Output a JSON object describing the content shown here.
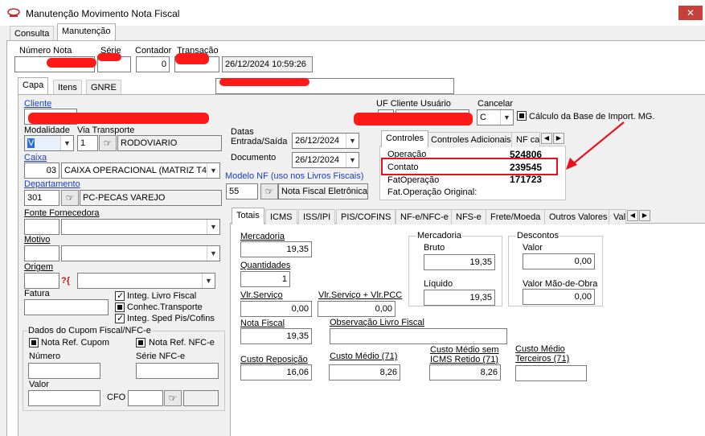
{
  "window": {
    "title": "Manutenção Movimento Nota Fiscal",
    "close_glyph": "✕"
  },
  "top_tabs": [
    "Consulta",
    "Manutenção"
  ],
  "header": {
    "numero_nota_label": "Número Nota",
    "serie_label": "Série",
    "contador_label": "Contador",
    "contador_value": "0",
    "transacao_label": "Transação",
    "datetime": "26/12/2024 10:59:26"
  },
  "sub_tabs": [
    "Capa",
    "Itens",
    "GNRE"
  ],
  "capa": {
    "cliente_label": "Cliente",
    "modalidade_label": "Modalidade",
    "modalidade_value": "V",
    "via_transporte_label": "Via Transporte",
    "via_transporte_code": "1",
    "via_transporte_desc": "RODOVIARIO",
    "caixa_label": "Caixa",
    "caixa_code": "03",
    "caixa_desc": "CAIXA OPERACIONAL (MATRIZ T4:",
    "departamento_label": "Departamento",
    "departamento_code": "301",
    "departamento_desc": "PC-PECAS VAREJO",
    "fonte_fornecedora_label": "Fonte Fornecedora",
    "motivo_label": "Motivo",
    "origem_label": "Origem",
    "origem_icon": "?{",
    "fatura_label": "Fatura",
    "integ_livro_fiscal": "Integ. Livro Fiscal",
    "conhec_transporte": "Conhec.Transporte",
    "integ_sped": "Integ. Sped Pis/Cofins",
    "datas_label": "Datas",
    "entrada_saida_label": "Entrada/Saída",
    "entrada_saida_value": "26/12/2024",
    "documento_label": "Documento",
    "documento_value": "26/12/2024",
    "modelo_nf_label": "Modelo NF (uso nos Livros Fiscais)",
    "modelo_nf_code": "55",
    "modelo_nf_desc": "Nota Fiscal Eletrônica",
    "uf_cliente_label": "UF Cliente Usuário",
    "cancelar_label": "Cancelar",
    "cancelar_value": "C",
    "calculo_base_label": "Cálculo da Base de Import. MG."
  },
  "cupom": {
    "title": "Dados do Cupom Fiscal/NFC-e",
    "nota_ref_cupom": "Nota Ref. Cupom",
    "nota_ref_nfce": "Nota Ref. NFC-e",
    "numero_label": "Número",
    "serie_nfce_label": "Série NFC-e",
    "valor_label": "Valor",
    "cfo_label": "CFO"
  },
  "controles": {
    "tabs": [
      "Controles",
      "Controles Adicionais",
      "NF ca"
    ],
    "rows": [
      {
        "label": "Operação",
        "value": "524806"
      },
      {
        "label": "Contato",
        "value": "239545"
      },
      {
        "label": "FatOperação",
        "value": "171723"
      },
      {
        "label": "Fat.Operação Original:",
        "value": ""
      }
    ]
  },
  "totais_tabs": [
    "Totais",
    "ICMS",
    "ISS/IPI",
    "PIS/COFINS",
    "NF-e/NFC-e",
    "NFS-e",
    "Frete/Moeda",
    "Outros Valores",
    "Val"
  ],
  "totais": {
    "mercadoria_label": "Mercadoria",
    "mercadoria_value": "19,35",
    "quantidades_label": "Quantidades",
    "quantidades_value": "1",
    "mercadoria_group_title": "Mercadoria",
    "bruto_label": "Bruto",
    "bruto_value": "19,35",
    "liquido_label": "Líquido",
    "liquido_value": "19,35",
    "descontos_title": "Descontos",
    "desc_valor_label": "Valor",
    "desc_valor_value": "0,00",
    "valor_mao_obra_label": "Valor Mão-de-Obra",
    "valor_mao_obra_value": "0,00",
    "vlr_servico_label": "Vlr.Serviço",
    "vlr_servico_value": "0,00",
    "vlr_servico_pcc_label": "Vlr.Serviço + Vlr.PCC",
    "vlr_servico_pcc_value": "0,00",
    "nota_fiscal_label": "Nota Fiscal",
    "nota_fiscal_value": "19,35",
    "obs_livro_label": "Observação Livro Fiscal",
    "custo_reposicao_label": "Custo Reposição",
    "custo_reposicao_value": "16,06",
    "custo_medio_label": "Custo Médio (71)",
    "custo_medio_value": "8,26",
    "custo_medio_sem_icms_label_1": "Custo Médio sem",
    "custo_medio_sem_icms_label_2": "ICMS Retido (71)",
    "custo_medio_sem_icms_value": "8,26",
    "custo_medio_terceiros_label_1": "Custo Médio",
    "custo_medio_terceiros_label_2": "Terceiros (71)"
  },
  "colors": {
    "annotation_red": "#e8101c",
    "window_bg": "#f0f0f0"
  }
}
